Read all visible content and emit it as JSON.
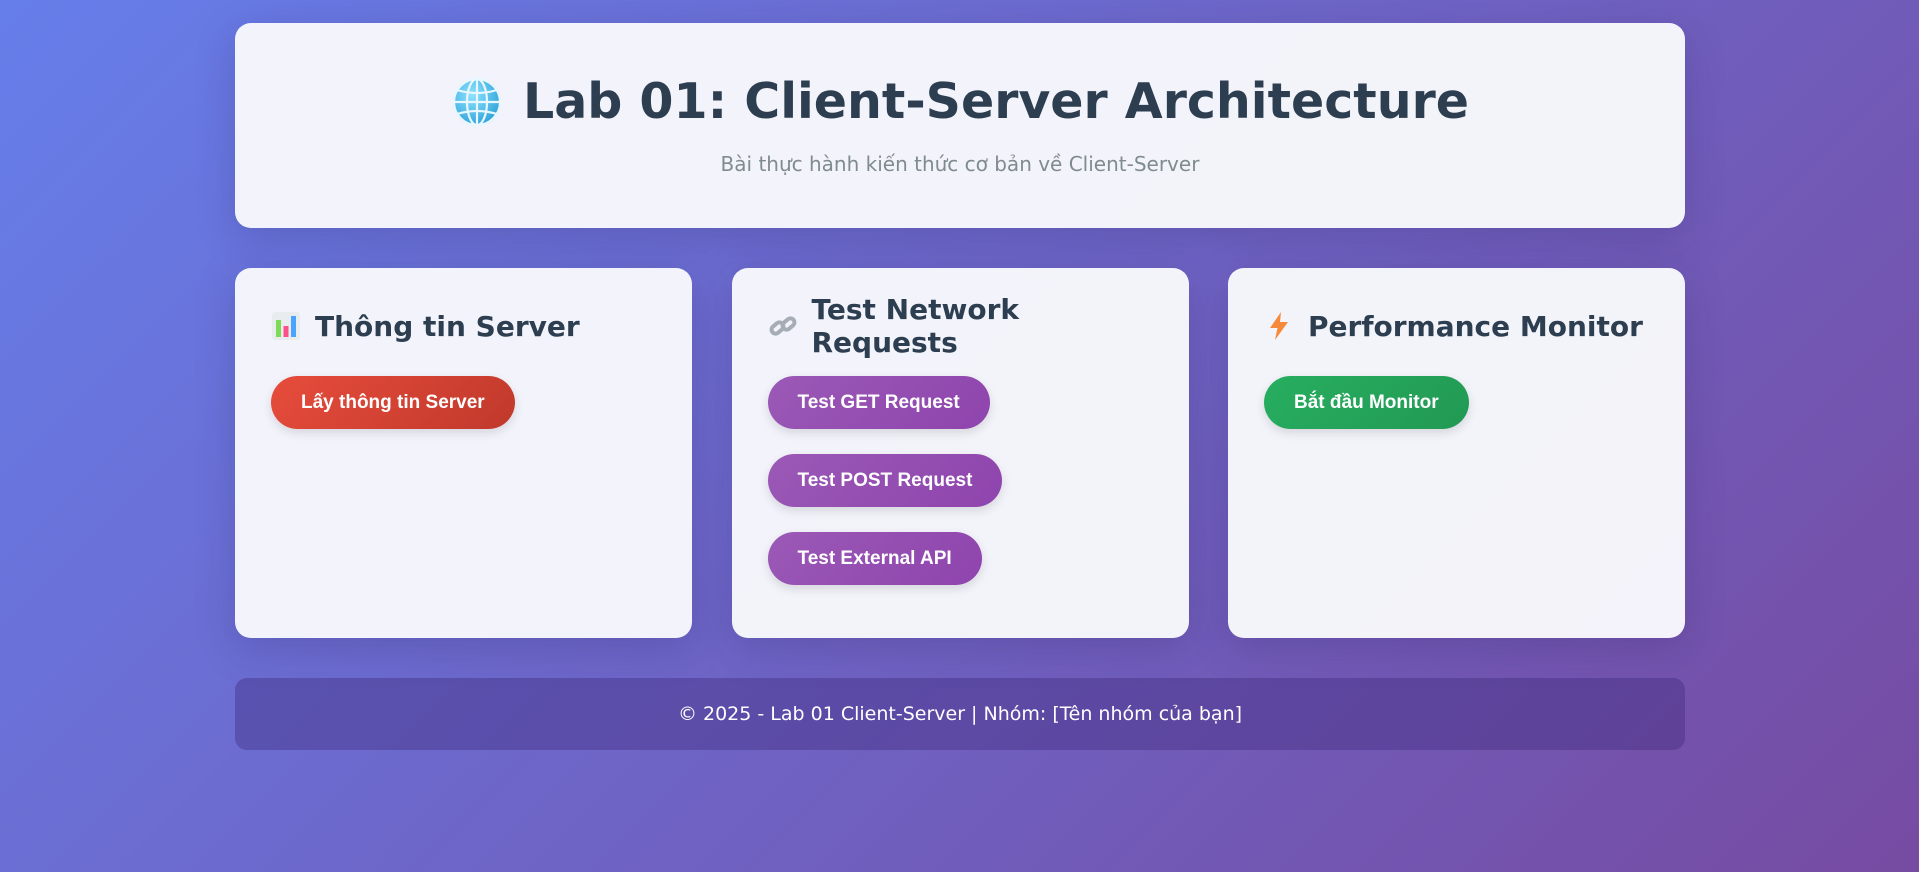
{
  "header": {
    "icon": "globe-icon",
    "title": "Lab 01: Client-Server Architecture",
    "subtitle": "Bài thực hành kiến thức cơ bản về Client-Server"
  },
  "cards": [
    {
      "icon": "bar-chart-icon",
      "title": "Thông tin Server",
      "buttons": [
        {
          "label": "Lấy thông tin Server",
          "color": "#e74c3c"
        }
      ]
    },
    {
      "icon": "link-icon",
      "title": "Test Network Requests",
      "buttons": [
        {
          "label": "Test GET Request",
          "color": "#9b59b6"
        },
        {
          "label": "Test POST Request",
          "color": "#9b59b6"
        },
        {
          "label": "Test External API",
          "color": "#9b59b6"
        }
      ]
    },
    {
      "icon": "lightning-icon",
      "title": "Performance Monitor",
      "buttons": [
        {
          "label": "Bắt đầu Monitor",
          "color": "#27ae60"
        }
      ]
    }
  ],
  "footer": {
    "text": "© 2025 - Lab 01 Client-Server | Nhóm: [Tên nhóm của bạn]"
  },
  "colors": {
    "background_start": "#667eea",
    "background_end": "#764ba2",
    "heading": "#2c3e50",
    "subtitle": "#7f8c8d"
  }
}
